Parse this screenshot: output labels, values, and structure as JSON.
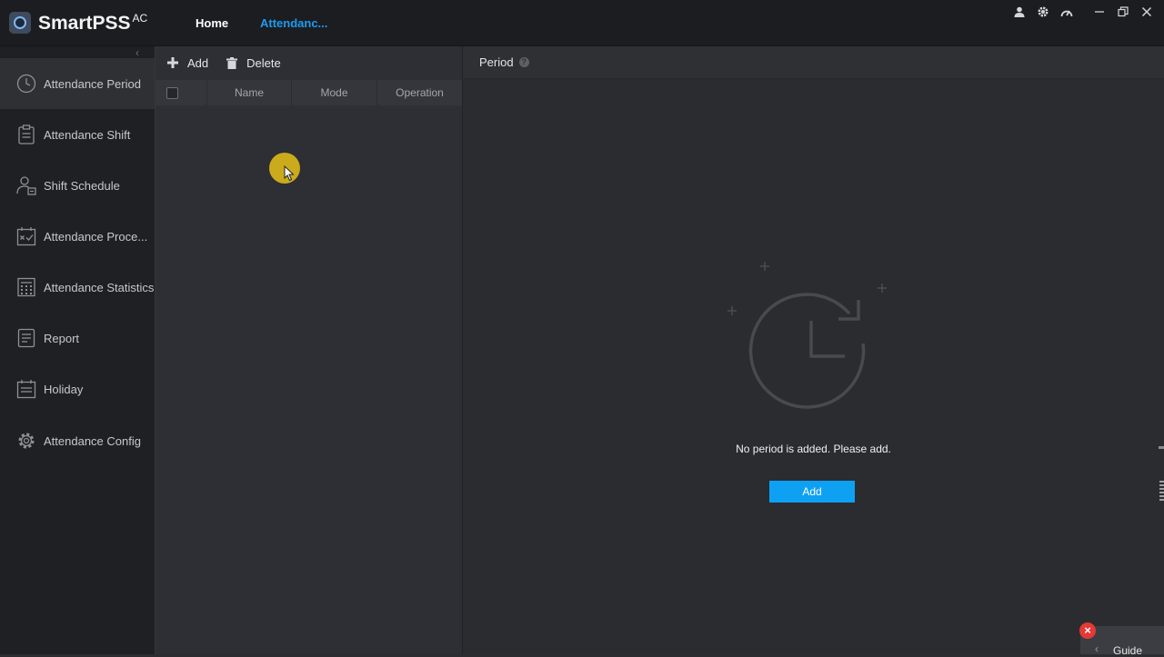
{
  "app": {
    "name": "SmartPSS",
    "name_sup": "AC",
    "tabs": [
      {
        "label": "Home"
      },
      {
        "label": "Attendanc..."
      }
    ]
  },
  "window_controls": {
    "icons": [
      "user-icon",
      "settings-icon",
      "performance-icon",
      "minimize-icon",
      "restore-icon",
      "close-icon"
    ]
  },
  "sidebar": {
    "items": [
      {
        "label": "Attendance Period",
        "icon": "clock-icon",
        "active": true
      },
      {
        "label": "Attendance Shift",
        "icon": "clipboard-icon"
      },
      {
        "label": "Shift Schedule",
        "icon": "person-schedule-icon"
      },
      {
        "label": "Attendance Proce...",
        "icon": "calendar-check-icon"
      },
      {
        "label": "Attendance Statistics",
        "icon": "calculator-icon"
      },
      {
        "label": "Report",
        "icon": "report-icon"
      },
      {
        "label": "Holiday",
        "icon": "calendar-icon"
      },
      {
        "label": "Attendance Config",
        "icon": "gear-icon"
      }
    ]
  },
  "list_panel": {
    "add_label": "Add",
    "delete_label": "Delete",
    "columns": [
      "Name",
      "Mode",
      "Operation"
    ],
    "rows": []
  },
  "main": {
    "title": "Period",
    "empty_message": "No period is added. Please add.",
    "add_button": "Add"
  },
  "guide": {
    "label": "Guide"
  },
  "colors": {
    "accent": "#1e9bf0",
    "button": "#0ea1f3",
    "cursor_highlight": "#d9b51a",
    "close_red": "#e53935"
  }
}
